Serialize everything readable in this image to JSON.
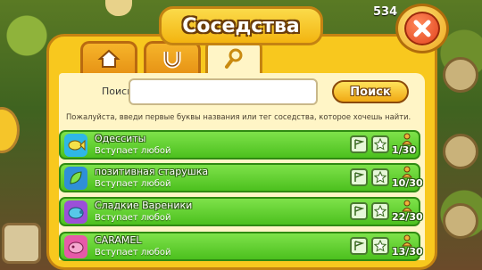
{
  "window": {
    "title": "Соседства"
  },
  "tabs": [
    {
      "icon": "house-icon"
    },
    {
      "icon": "horseshoe-icon"
    },
    {
      "icon": "magnifier-icon",
      "active": true
    }
  ],
  "search": {
    "label": "Поиск",
    "value": "",
    "button": "Поиск",
    "hint": "Пожалуйста, введи первые буквы названия или тег соседства, которое хочешь найти."
  },
  "background": {
    "top_counter": "534"
  },
  "neighborhoods": [
    {
      "name": "Одесситы",
      "join": "Вступает любой",
      "members": "1/30",
      "emblem_color": "#2fb7e6",
      "emblem_icon": "fish-icon"
    },
    {
      "name": "позитивная старушка",
      "join": "Вступает любой",
      "members": "10/30",
      "emblem_color": "#2f8fd8",
      "emblem_icon": "leaf-icon"
    },
    {
      "name": "Сладкие Вареники",
      "join": "Вступает любой",
      "members": "22/30",
      "emblem_color": "#9b4fd8",
      "emblem_icon": "pig-icon"
    },
    {
      "name": "CARAMEL",
      "join": "Вступает любой",
      "members": "13/30",
      "emblem_color": "#e65aa8",
      "emblem_icon": "cow-icon"
    }
  ]
}
